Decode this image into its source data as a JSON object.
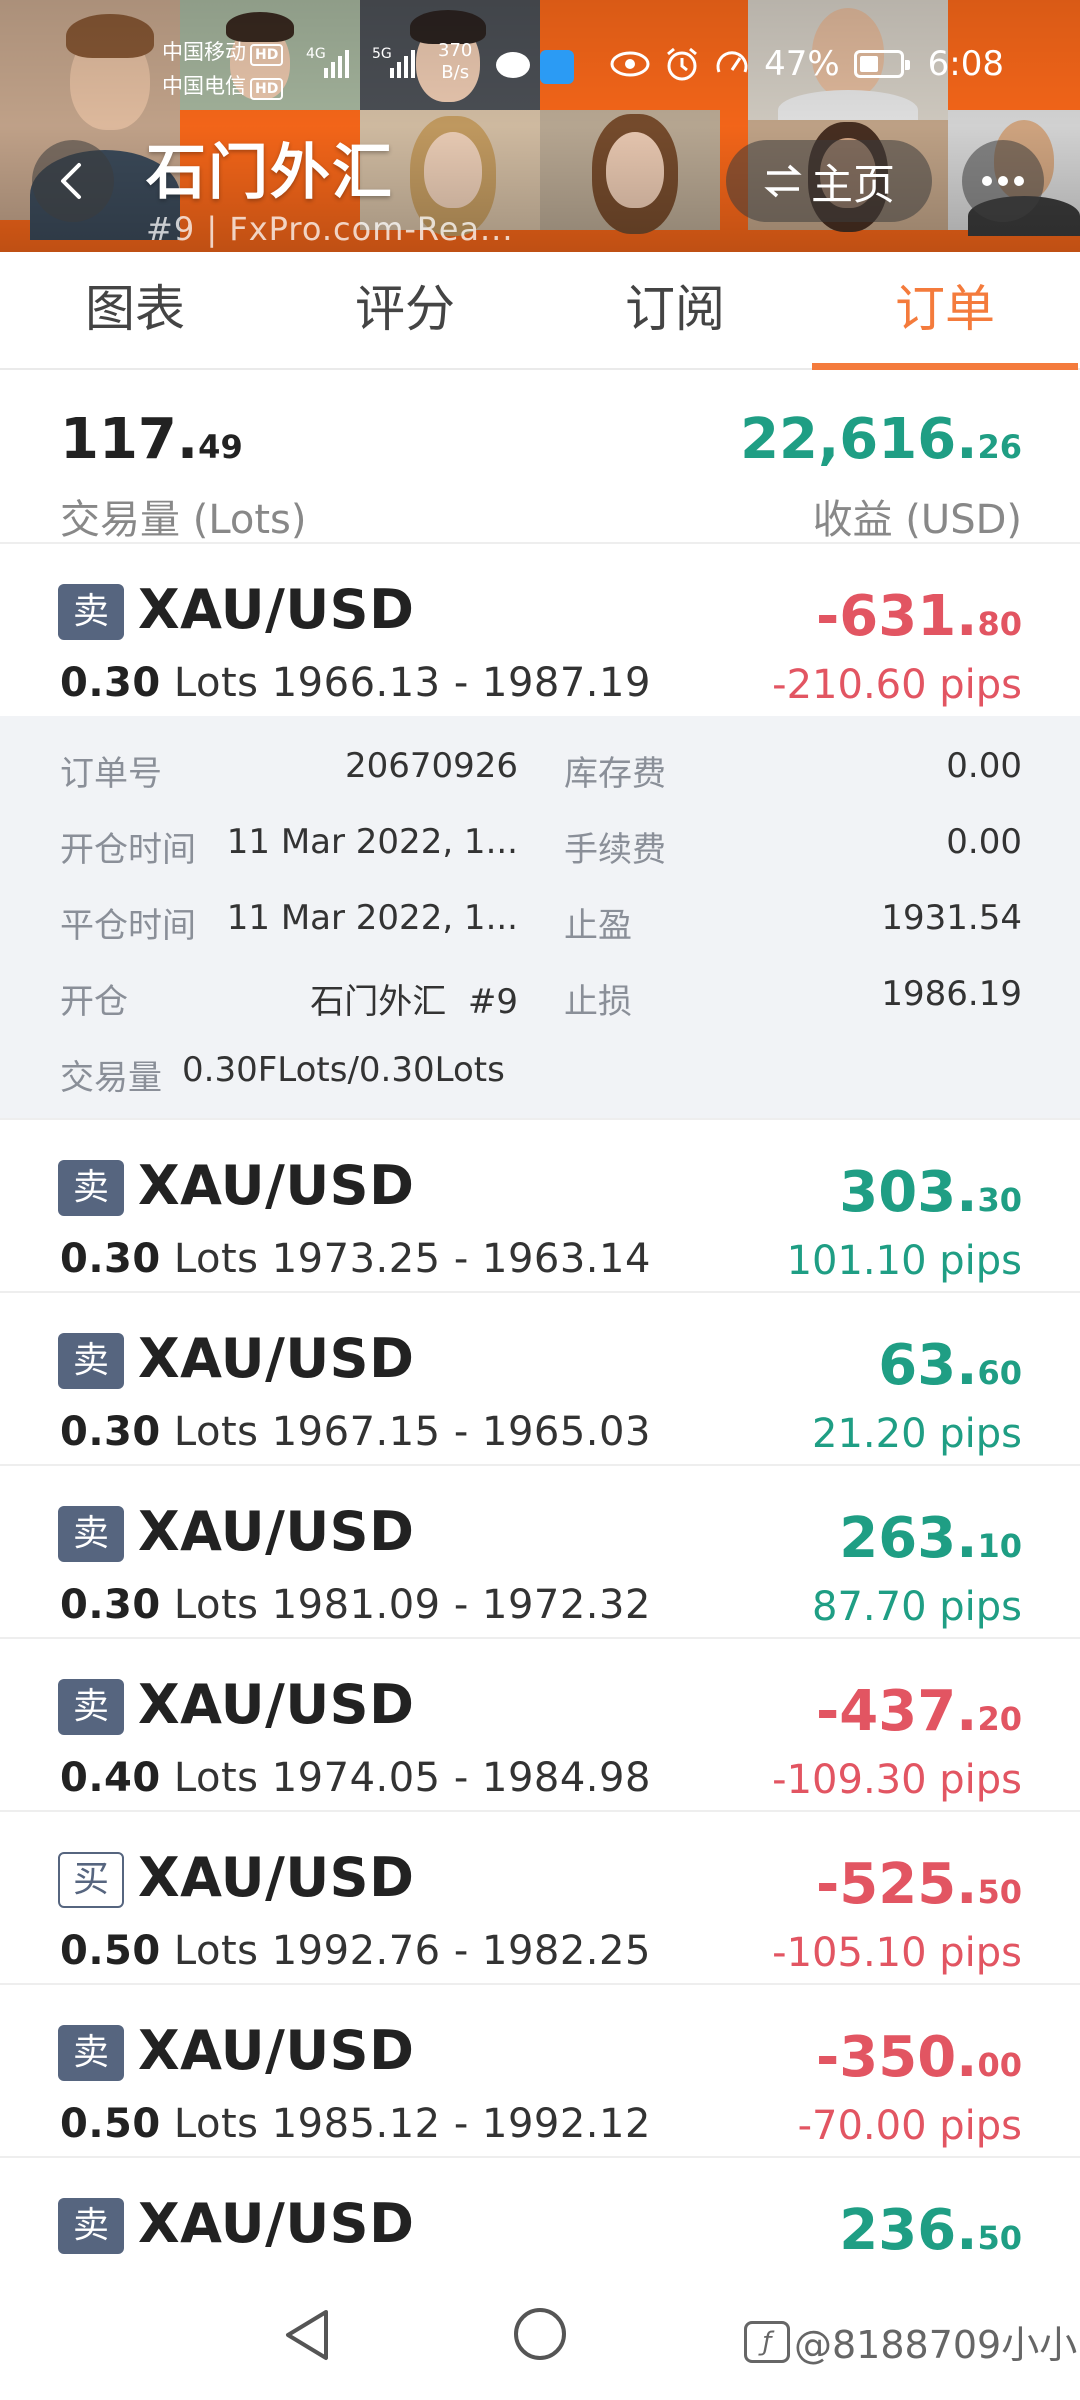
{
  "status_bar": {
    "carrier1": "中国移动",
    "carrier2": "中国电信",
    "hd_badge": "HD",
    "net_type_4g": "4G",
    "net_type_5g": "5G",
    "net_speed_value": "370",
    "net_speed_unit": "B/s",
    "battery_percent": "47%",
    "battery_level": 0.47,
    "time": "6:08"
  },
  "header": {
    "title": "石门外汇",
    "subtitle": "#9 | FxPro.com-Rea...",
    "home_label": "主页",
    "accent_color": "#ff6a1a"
  },
  "tabs": [
    {
      "label": "图表",
      "active": false
    },
    {
      "label": "评分",
      "active": false
    },
    {
      "label": "订阅",
      "active": false
    },
    {
      "label": "订单",
      "active": true
    }
  ],
  "summary": {
    "volume_int": "117.",
    "volume_dec": "49",
    "volume_label": "交易量 (Lots)",
    "profit_int": "22,616.",
    "profit_dec": "26",
    "profit_label": "收益 (USD)"
  },
  "orders": [
    {
      "side": "卖",
      "symbol": "XAU/USD",
      "lots": "0.30",
      "lots_unit": "Lots",
      "range": "1966.13 - 1987.19",
      "profit_int": "-631.",
      "profit_dec": "80",
      "pips": "-210.60 pips",
      "positive": false
    },
    {
      "side": "卖",
      "symbol": "XAU/USD",
      "lots": "0.30",
      "lots_unit": "Lots",
      "range": "1973.25 - 1963.14",
      "profit_int": "303.",
      "profit_dec": "30",
      "pips": "101.10 pips",
      "positive": true
    },
    {
      "side": "卖",
      "symbol": "XAU/USD",
      "lots": "0.30",
      "lots_unit": "Lots",
      "range": "1967.15 - 1965.03",
      "profit_int": "63.",
      "profit_dec": "60",
      "pips": "21.20 pips",
      "positive": true
    },
    {
      "side": "卖",
      "symbol": "XAU/USD",
      "lots": "0.30",
      "lots_unit": "Lots",
      "range": "1981.09 - 1972.32",
      "profit_int": "263.",
      "profit_dec": "10",
      "pips": "87.70 pips",
      "positive": true
    },
    {
      "side": "卖",
      "symbol": "XAU/USD",
      "lots": "0.40",
      "lots_unit": "Lots",
      "range": "1974.05 - 1984.98",
      "profit_int": "-437.",
      "profit_dec": "20",
      "pips": "-109.30 pips",
      "positive": false
    },
    {
      "side": "买",
      "symbol": "XAU/USD",
      "lots": "0.50",
      "lots_unit": "Lots",
      "range": "1992.76 - 1982.25",
      "profit_int": "-525.",
      "profit_dec": "50",
      "pips": "-105.10 pips",
      "positive": false
    },
    {
      "side": "卖",
      "symbol": "XAU/USD",
      "lots": "0.50",
      "lots_unit": "Lots",
      "range": "1985.12 - 1992.12",
      "profit_int": "-350.",
      "profit_dec": "00",
      "pips": "-70.00 pips",
      "positive": false
    },
    {
      "side": "卖",
      "symbol": "XAU/USD",
      "profit_int": "236.",
      "profit_dec": "50",
      "positive": true
    }
  ],
  "detail": {
    "order_no_label": "订单号",
    "order_no": "20670926",
    "swap_label": "库存费",
    "swap": "0.00",
    "open_time_label": "开仓时间",
    "open_time": "11 Mar 2022, 1...",
    "commission_label": "手续费",
    "commission": "0.00",
    "close_time_label": "平仓时间",
    "close_time": "11 Mar 2022, 1...",
    "take_profit_label": "止盈",
    "take_profit": "1931.54",
    "open_label": "开仓",
    "open_value": "石门外汇  #9",
    "stop_loss_label": "止损",
    "stop_loss": "1986.19",
    "volume_label": "交易量",
    "volume_value": "0.30FLots/0.30Lots"
  },
  "watermark": {
    "text": "@8188709小小",
    "icon_glyph": "ƒ"
  },
  "colors": {
    "green": "#1f9e84",
    "red": "#e25562",
    "tab_active": "#f47b3c",
    "badge": "#56657f"
  }
}
